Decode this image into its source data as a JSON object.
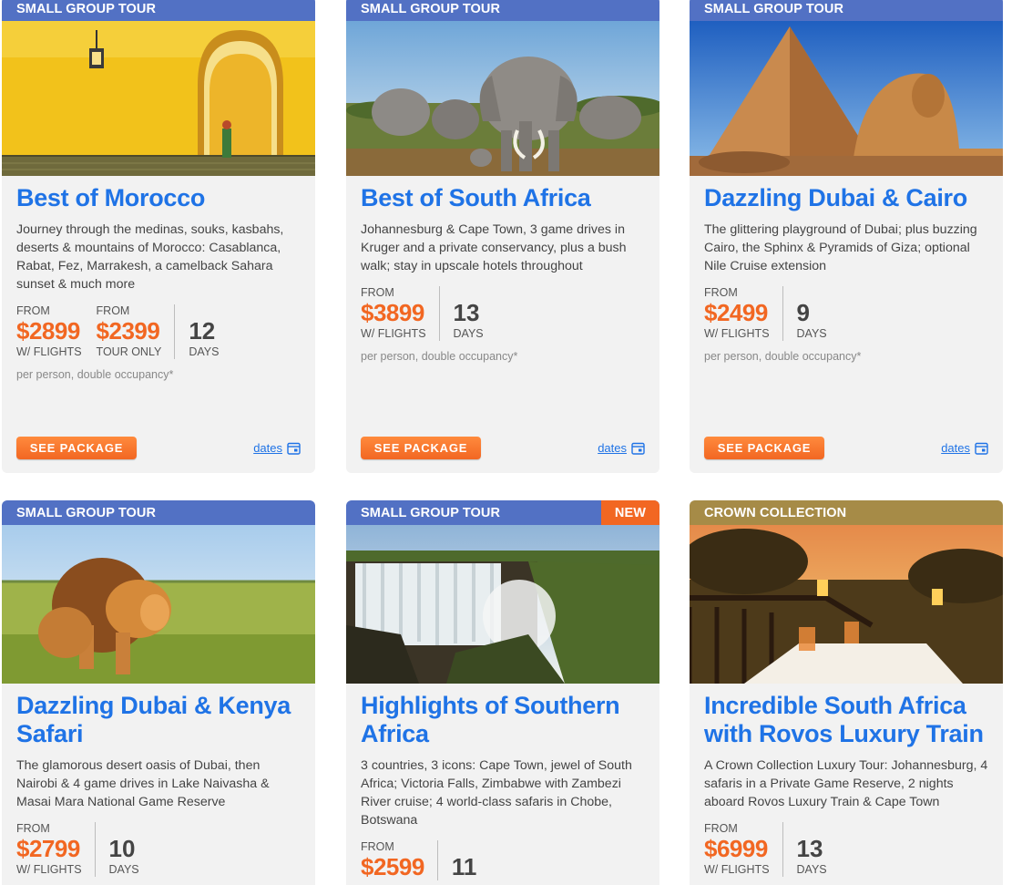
{
  "accent": "#1f73e6",
  "price_color": "#f26722",
  "cards": [
    {
      "ribbon": "SMALL GROUP TOUR",
      "title": "Best of Morocco",
      "desc": "Journey through the medinas, souks, kasbahs, deserts & mountains of Morocco: Casablanca, Rabat, Fez, Marrakesh, a camelback Sahara sunset & much more",
      "from1": "FROM",
      "price1": "$2899",
      "label1": "W/ FLIGHTS",
      "from2": "FROM",
      "price2": "$2399",
      "label2": "TOUR ONLY",
      "days": "12",
      "days_label": "DAYS",
      "occupancy": "per person, double occupancy*",
      "button": "SEE PACKAGE",
      "dates": "dates"
    },
    {
      "ribbon": "SMALL GROUP TOUR",
      "title": "Best of South Africa",
      "desc": "Johannesburg & Cape Town, 3 game drives in Kruger and a private conservancy, plus a bush walk; stay in upscale hotels throughout",
      "from1": "FROM",
      "price1": "$3899",
      "label1": "W/ FLIGHTS",
      "days": "13",
      "days_label": "DAYS",
      "occupancy": "per person, double occupancy*",
      "button": "SEE PACKAGE",
      "dates": "dates"
    },
    {
      "ribbon": "SMALL GROUP TOUR",
      "title": "Dazzling Dubai & Cairo",
      "desc": "The glittering playground of Dubai; plus buzzing Cairo, the Sphinx & Pyramids of Giza; optional Nile Cruise extension",
      "from1": "FROM",
      "price1": "$2499",
      "label1": "W/ FLIGHTS",
      "days": "9",
      "days_label": "DAYS",
      "occupancy": "per person, double occupancy*",
      "button": "SEE PACKAGE",
      "dates": "dates"
    },
    {
      "ribbon": "SMALL GROUP TOUR",
      "title": "Dazzling Dubai & Kenya Safari",
      "desc": "The glamorous desert oasis of Dubai, then Nairobi & 4 game drives in Lake Naivasha & Masai Mara National Game Reserve",
      "from1": "FROM",
      "price1": "$2799",
      "label1": "W/ FLIGHTS",
      "days": "10",
      "days_label": "DAYS"
    },
    {
      "ribbon": "SMALL GROUP TOUR",
      "badge": "NEW",
      "title": "Highlights of Southern Africa",
      "desc": "3 countries, 3 icons: Cape Town, jewel of South Africa; Victoria Falls, Zimbabwe with Zambezi River cruise; 4 world-class safaris in Chobe, Botswana",
      "from1": "FROM",
      "price1": "$2599",
      "days": "11"
    },
    {
      "ribbon": "CROWN COLLECTION",
      "title": "Incredible South Africa with Rovos Luxury Train",
      "desc": "A Crown Collection Luxury Tour: Johannesburg, 4 safaris in a Private Game Reserve, 2 nights aboard Rovos Luxury Train & Cape Town",
      "from1": "FROM",
      "price1": "$6999",
      "label1": "W/ FLIGHTS",
      "days": "13",
      "days_label": "DAYS"
    }
  ]
}
